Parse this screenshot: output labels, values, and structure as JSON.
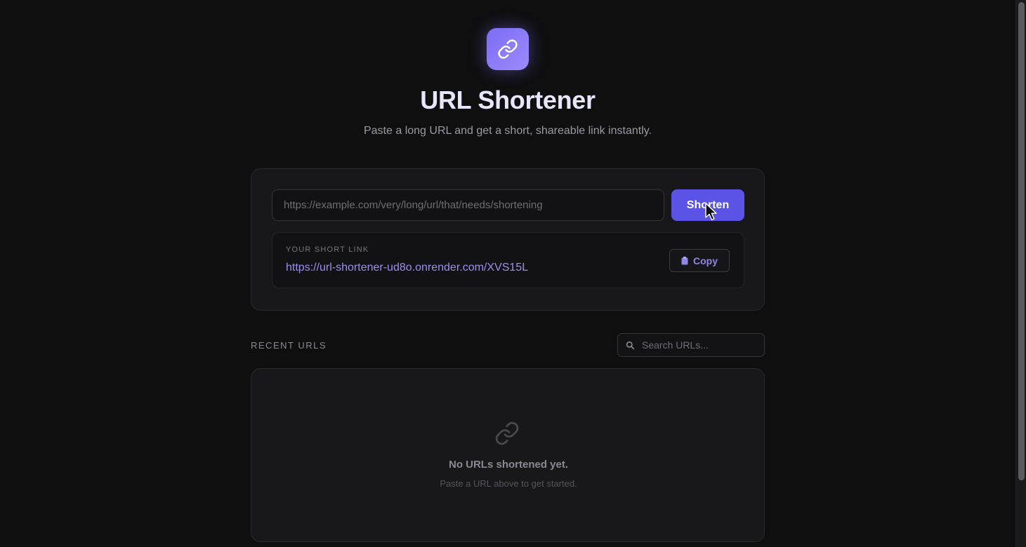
{
  "header": {
    "logo_icon": "link-icon",
    "title": "URL Shortener",
    "subtitle": "Paste a long URL and get a short, shareable link instantly."
  },
  "shortener": {
    "input_value": "",
    "input_placeholder": "https://example.com/very/long/url/that/needs/shortening",
    "shorten_label": "Shorten",
    "result_label": "YOUR SHORT LINK",
    "short_link": "https://url-shortener-ud8o.onrender.com/XVS15L",
    "copy_label": "Copy",
    "copy_icon": "clipboard-icon"
  },
  "recent": {
    "label": "RECENT URLS",
    "search_placeholder": "Search URLs...",
    "search_icon": "search-icon",
    "empty_icon": "link-icon",
    "empty_title": "No URLs shortened yet.",
    "empty_subtitle": "Paste a URL above to get started."
  },
  "colors": {
    "background": "#0f0f10",
    "card": "#18181a",
    "accent": "#5b52e6",
    "logo_gradient_start": "#7c6cf5",
    "logo_gradient_end": "#9b8cfb",
    "link": "#9a8ff0"
  }
}
